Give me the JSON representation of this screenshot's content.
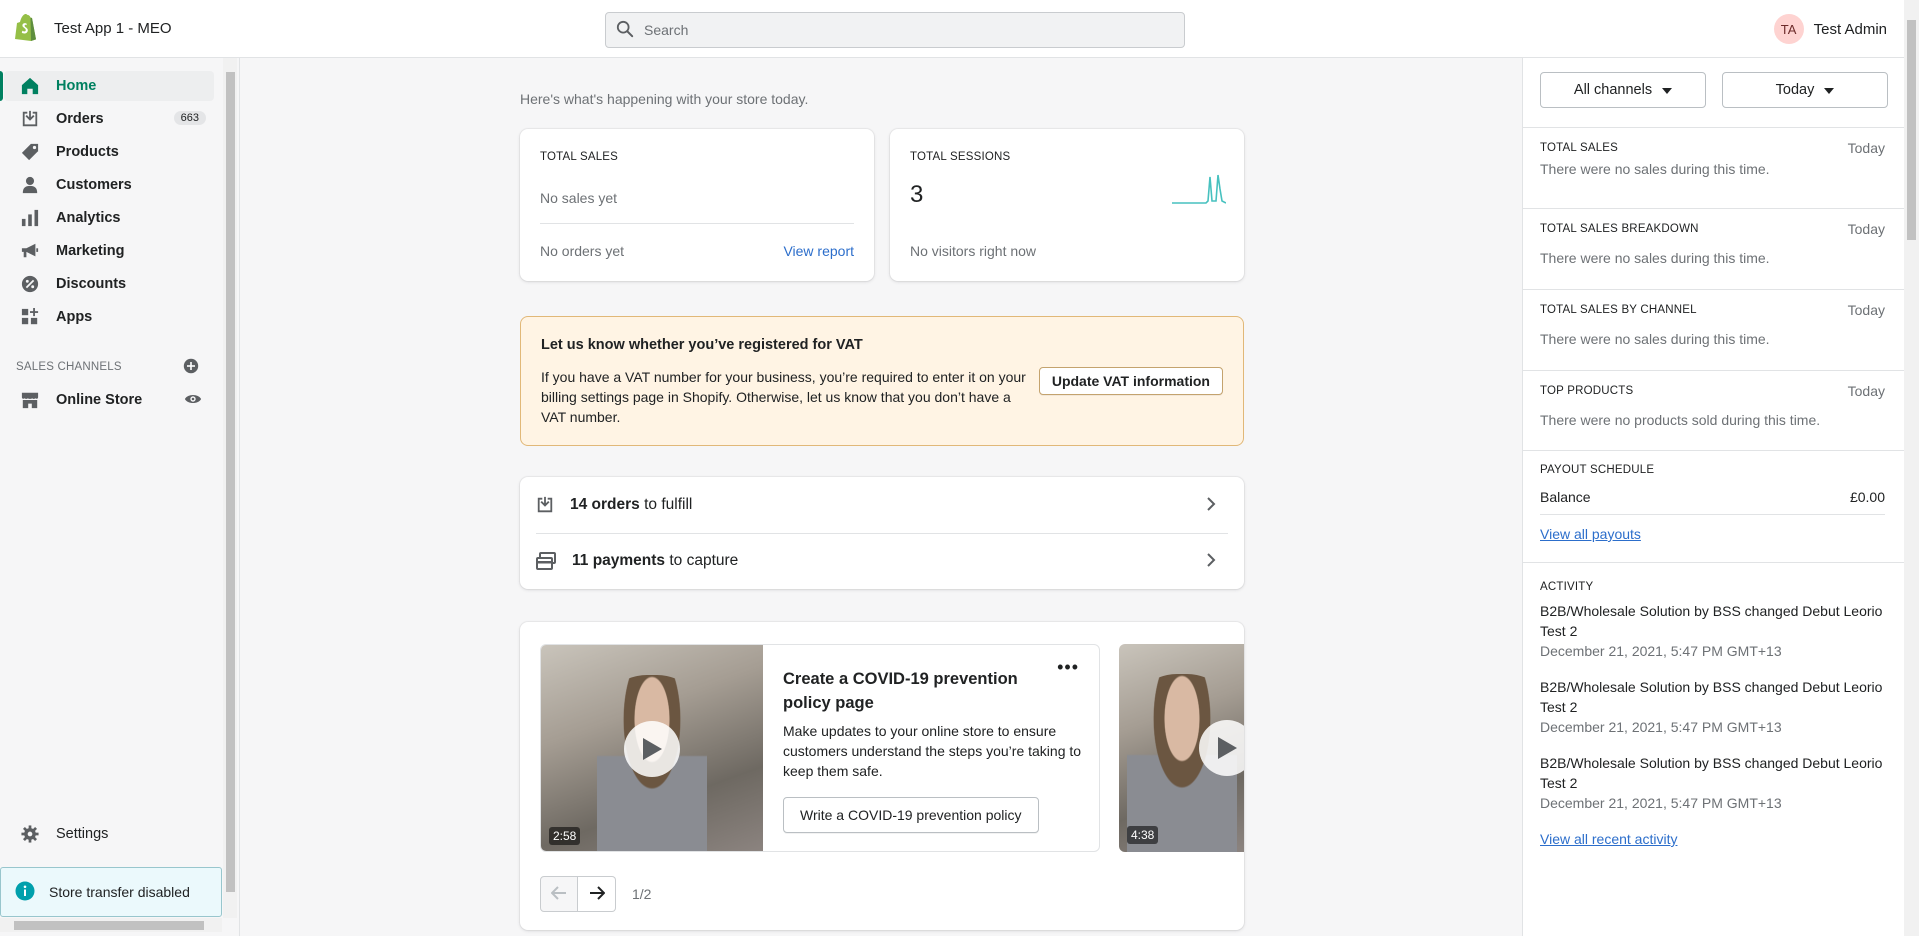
{
  "topbar": {
    "store_name": "Test App 1 - MEO",
    "search_placeholder": "Search",
    "user_initials": "TA",
    "user_name": "Test Admin"
  },
  "sidebar": {
    "items": [
      {
        "label": "Home",
        "icon": "home-icon"
      },
      {
        "label": "Orders",
        "icon": "orders-icon",
        "badge": "663"
      },
      {
        "label": "Products",
        "icon": "tag-icon"
      },
      {
        "label": "Customers",
        "icon": "person-icon"
      },
      {
        "label": "Analytics",
        "icon": "bar-chart-icon"
      },
      {
        "label": "Marketing",
        "icon": "megaphone-icon"
      },
      {
        "label": "Discounts",
        "icon": "discount-icon"
      },
      {
        "label": "Apps",
        "icon": "apps-icon"
      }
    ],
    "sales_channels_title": "SALES CHANNELS",
    "online_store": "Online Store",
    "settings": "Settings",
    "store_transfer": "Store transfer disabled"
  },
  "main": {
    "greeting": "Here's what's happening with your store today.",
    "total_sales": {
      "label": "TOTAL SALES",
      "value": "No sales yet",
      "footer": "No orders yet",
      "link": "View report"
    },
    "total_sessions": {
      "label": "TOTAL SESSIONS",
      "value": "3",
      "footer": "No visitors right now"
    },
    "vat": {
      "title": "Let us know whether you’ve registered for VAT",
      "text": "If you have a VAT number for your business, you’re required to enter it on your billing settings page in Shopify. Otherwise, let us know that you don’t have a VAT number.",
      "button": "Update VAT information"
    },
    "tasks": [
      {
        "count": "14 orders",
        "rest": " to fulfill"
      },
      {
        "count": "11 payments",
        "rest": " to capture"
      }
    ],
    "promo": {
      "title": "Create a COVID-19 prevention policy page",
      "text": "Make updates to your online store to ensure customers understand the steps you’re taking to keep them safe.",
      "button": "Write a COVID-19 prevention policy",
      "duration1": "2:58",
      "duration2": "4:38",
      "page": "1/2"
    }
  },
  "right_panel": {
    "channel_select": "All channels",
    "date_select": "Today",
    "sections": [
      {
        "title": "TOTAL SALES",
        "date": "Today",
        "text": "There were no sales during this time."
      },
      {
        "title": "TOTAL SALES BREAKDOWN",
        "date": "Today",
        "text": "There were no sales during this time."
      },
      {
        "title": "TOTAL SALES BY CHANNEL",
        "date": "Today",
        "text": "There were no sales during this time."
      },
      {
        "title": "TOP PRODUCTS",
        "date": "Today",
        "text": "There were no products sold during this time."
      }
    ],
    "payout": {
      "title": "PAYOUT SCHEDULE",
      "balance_label": "Balance",
      "balance_value": "£0.00",
      "link": "View all payouts"
    },
    "activity": {
      "title": "ACTIVITY",
      "items": [
        {
          "text": "B2B/Wholesale Solution by BSS changed Debut Leorio Test 2",
          "time": "December 21, 2021, 5:47 PM GMT+13"
        },
        {
          "text": "B2B/Wholesale Solution by BSS changed Debut Leorio Test 2",
          "time": "December 21, 2021, 5:47 PM GMT+13"
        },
        {
          "text": "B2B/Wholesale Solution by BSS changed Debut Leorio Test 2",
          "time": "December 21, 2021, 5:47 PM GMT+13"
        }
      ],
      "link": "View all recent activity"
    }
  },
  "colors": {
    "accent": "#008060",
    "link": "#2c6ecb",
    "vat_background": "#fff4e4",
    "sparkline": "#47c1bf"
  }
}
